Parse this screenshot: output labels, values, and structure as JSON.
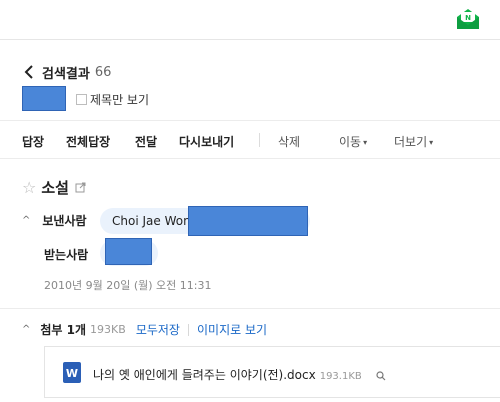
{
  "header": {
    "mail_icon": "envelope-icon",
    "icon_color": "#10b44a"
  },
  "nav": {
    "back_label": "검색결과",
    "result_count": "66"
  },
  "filter": {
    "subject_only_label": "제목만 보기"
  },
  "toolbar": {
    "reply": "답장",
    "reply_all": "전체답장",
    "forward": "전달",
    "resend": "다시보내기",
    "delete": "삭제",
    "move": "이동",
    "more": "더보기",
    "caret": "▾"
  },
  "mail": {
    "subject": "소설",
    "from_label": "보낸사람",
    "sender_name": "Choi Jae Won",
    "to_label": "받는사람",
    "date": "2010년 9월 20일 (월) 오전 11:31"
  },
  "attachment": {
    "label": "첨부 1개",
    "total_size": "193KB",
    "save_all": "모두저장",
    "view_as_image": "이미지로 보기",
    "file_name": "나의 옛 애인에게 들려주는 이야기(전).docx",
    "file_size": "193.1KB",
    "file_icon": "word-doc-icon",
    "icon_color": "#2b5fb6"
  },
  "colors": {
    "redaction": "#4a86d8",
    "link": "#1a68c7",
    "chip": "#eaf2fc"
  }
}
